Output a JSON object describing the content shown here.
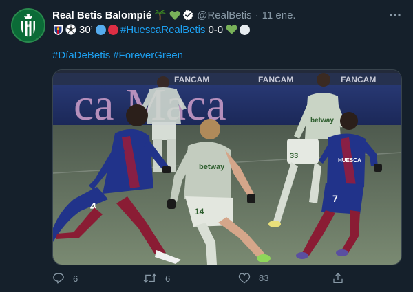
{
  "tweet": {
    "display_name": "Real Betis Balompié",
    "name_emojis": [
      "palm-tree",
      "green-heart"
    ],
    "handle": "@RealBetis",
    "separator": "·",
    "timestamp": "11 ene.",
    "line1": {
      "minute": "30’",
      "hashtag": "#HuescaRealBetis",
      "score": "0-0"
    },
    "line2": {
      "hashtags": [
        "#DíaDeBetis",
        "#ForeverGreen"
      ]
    },
    "media": {
      "alt": "Huesca vs Real Betis match photo",
      "banner_text": "ca Maca",
      "ads": [
        "FANCAM",
        "FANCAM",
        "FANCAM"
      ],
      "numbers": [
        "4",
        "14",
        "33",
        "7"
      ],
      "sponsor": "betway",
      "sponsor_huesca": "HUESCA"
    },
    "actions": {
      "replies": "6",
      "retweets": "6",
      "likes": "83"
    }
  },
  "colors": {
    "background": "#15202b",
    "accent": "#1da1f2",
    "secondary_text": "#8899a6",
    "betis_green": "#0b6b37"
  }
}
